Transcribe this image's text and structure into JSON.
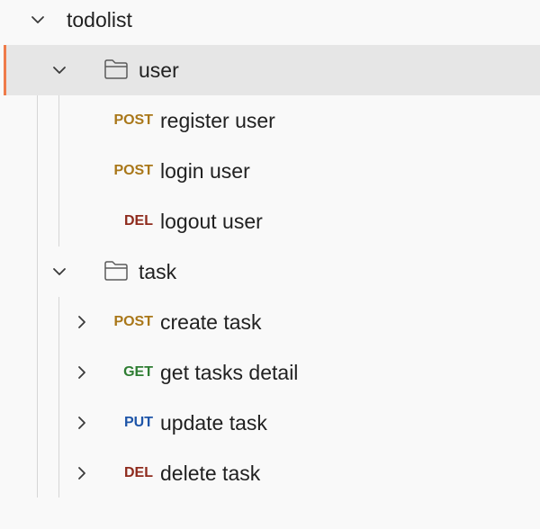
{
  "colors": {
    "post": "#a97719",
    "get": "#2e7d32",
    "put": "#1e55a8",
    "del": "#8e2a1c",
    "selected_bar": "#ef7b4a",
    "selected_bg": "#e6e6e6"
  },
  "collection": {
    "name": "todolist",
    "icon": "chevron-down-icon"
  },
  "folders": [
    {
      "name": "user",
      "icon": "folder-icon",
      "expanded": true,
      "selected": true,
      "requests": [
        {
          "method": "POST",
          "name": "register user"
        },
        {
          "method": "POST",
          "name": "login user"
        },
        {
          "method": "DEL",
          "name": "logout user"
        }
      ]
    },
    {
      "name": "task",
      "icon": "folder-icon",
      "expanded": true,
      "selected": false,
      "requests": [
        {
          "method": "POST",
          "name": "create task",
          "icon": "chevron-right-icon"
        },
        {
          "method": "GET",
          "name": "get tasks detail",
          "icon": "chevron-right-icon"
        },
        {
          "method": "PUT",
          "name": "update task",
          "icon": "chevron-right-icon"
        },
        {
          "method": "DEL",
          "name": "delete task",
          "icon": "chevron-right-icon"
        }
      ]
    }
  ]
}
